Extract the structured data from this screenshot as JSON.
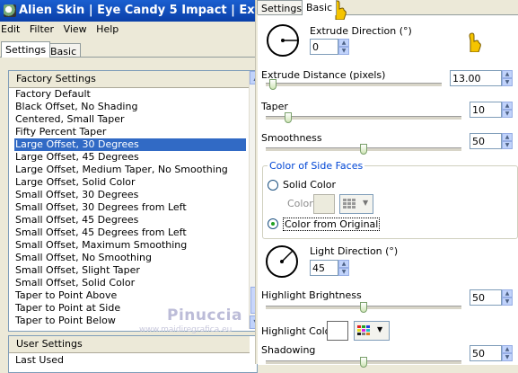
{
  "window": {
    "title": "Alien Skin | Eye Candy 5 Impact | Extrude"
  },
  "menu": [
    "Edit",
    "Filter",
    "View",
    "Help"
  ],
  "left_tabs": [
    "Settings",
    "Basic"
  ],
  "factory_settings": {
    "header": "Factory Settings",
    "items": [
      "Factory Default",
      "Black Offset, No Shading",
      "Centered, Small Taper",
      "Fifty Percent Taper",
      "Large Offset, 30 Degrees",
      "Large Offset, 45 Degrees",
      "Large Offset, Medium Taper, No Smoothing",
      "Large Offset, Solid Color",
      "Small Offset, 30 Degrees",
      "Small Offset, 30 Degrees from Left",
      "Small Offset, 45 Degrees",
      "Small Offset, 45 Degrees from Left",
      "Small Offset, Maximum Smoothing",
      "Small Offset, No Smoothing",
      "Small Offset, Slight Taper",
      "Small Offset, Solid Color",
      "Taper to Point Above",
      "Taper to Point at Side",
      "Taper to Point Below"
    ],
    "selected_index": 4
  },
  "user_settings": {
    "header": "User Settings",
    "items": [
      "Last Used"
    ]
  },
  "watermark": {
    "name": "Pinuccia",
    "url": "www.maidiregrafica.eu"
  },
  "right_tabs": [
    "Settings",
    "Basic"
  ],
  "basic": {
    "extrude_direction": {
      "label": "Extrude Direction (°)",
      "value": "0"
    },
    "extrude_distance": {
      "label": "Extrude Distance (pixels)",
      "value": "13.00",
      "level": 0.02
    },
    "taper": {
      "label": "Taper",
      "value": "10",
      "level": 0.1
    },
    "smoothness": {
      "label": "Smoothness",
      "value": "50",
      "level": 0.5
    },
    "side_faces": {
      "legend": "Color of Side Faces",
      "solid_color_label": "Solid Color",
      "color_label": "Color",
      "from_original_label": "Color from Original",
      "selected": "Color from Original"
    },
    "light_direction": {
      "label": "Light Direction (°)",
      "value": "45"
    },
    "highlight_brightness": {
      "label": "Highlight Brightness",
      "value": "50",
      "level": 0.5
    },
    "highlight_color": {
      "label": "Highlight Color",
      "swatch": "#ffffff"
    },
    "shadowing": {
      "label": "Shadowing",
      "value": "50",
      "level": 0.5
    }
  },
  "colors": {
    "selection": "#316ac5",
    "titlebar": "#0a3fa8",
    "hand_cursor": "#f5c400"
  }
}
